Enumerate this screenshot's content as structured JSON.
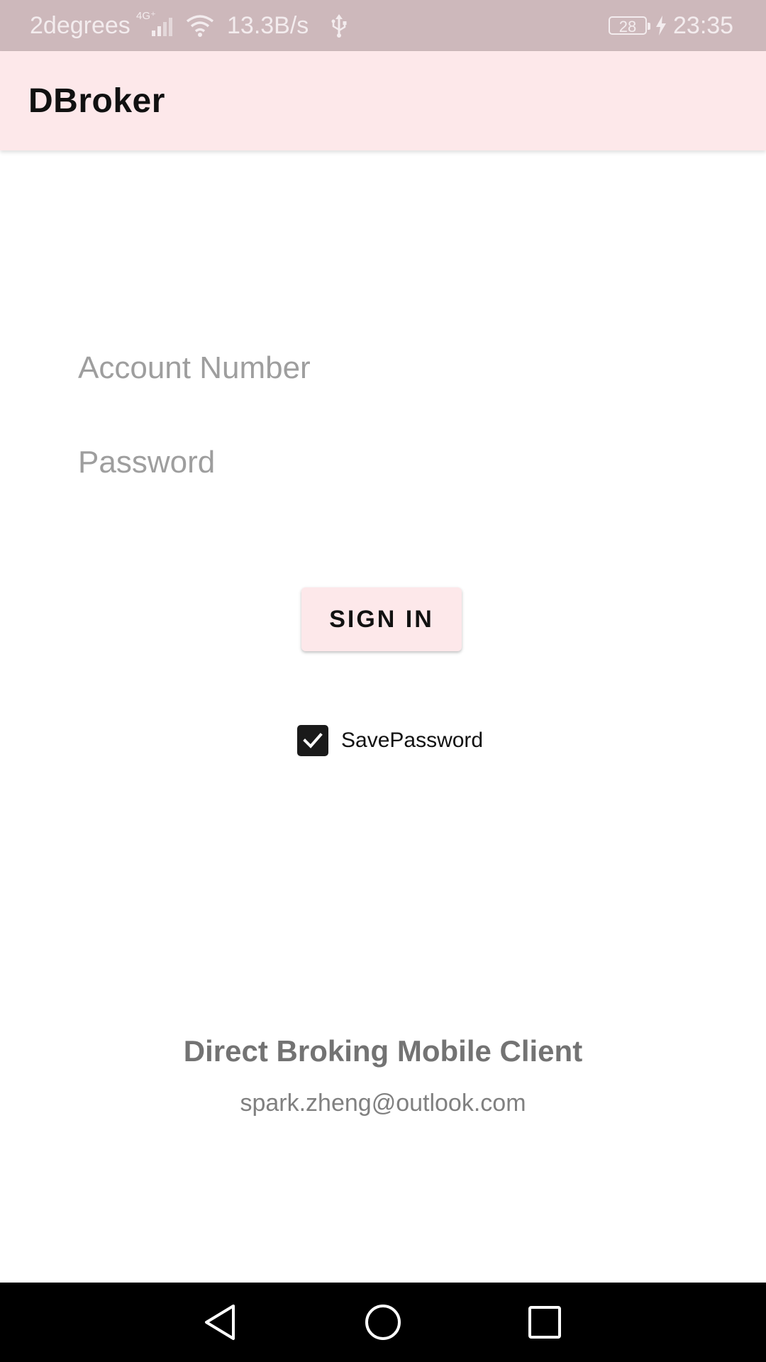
{
  "status_bar": {
    "carrier": "2degrees",
    "network_type": "4G⁺",
    "speed": "13.3B/s",
    "battery_level": "28",
    "time": "23:35",
    "icons": [
      "signal-icon",
      "wifi-icon",
      "usb-icon",
      "battery-icon",
      "charging-icon"
    ]
  },
  "app_bar": {
    "title": "DBroker"
  },
  "login_form": {
    "account_placeholder": "Account Number",
    "account_value": "",
    "password_placeholder": "Password",
    "password_value": "",
    "sign_in_label": "SIGN IN",
    "save_password_label": "SavePassword",
    "save_password_checked": true
  },
  "footer": {
    "title": "Direct Broking Mobile Client",
    "email": "spark.zheng@outlook.com"
  },
  "nav_bar": {
    "icons": [
      "back-icon",
      "home-icon",
      "recents-icon"
    ]
  },
  "colors": {
    "status_bar_bg": "#cdb8bb",
    "app_bar_bg": "#fde8ea",
    "button_bg": "#fde8ea",
    "checkbox_fill": "#1a1a1a",
    "nav_bar_bg": "#000000"
  }
}
